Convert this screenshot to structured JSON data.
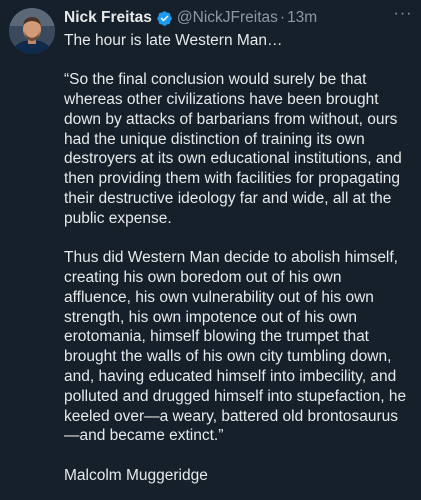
{
  "tweet": {
    "author": {
      "name": "Nick Freitas",
      "handle": "@NickJFreitas",
      "verified": true,
      "verified_color": "#1d9bf0"
    },
    "separator": "·",
    "timestamp": "13m",
    "more_icon": "ellipsis-icon",
    "more_label": "···",
    "paragraphs": {
      "intro": "The hour is late Western Man…",
      "quote1": "“So the final conclusion would surely be that whereas other civilizations have been brought down by attacks of barbarians from without, ours had the unique distinction of training its own destroyers at its own educational institutions, and then providing them with facilities for propagating their destructive ideology far and wide, all at the public expense.",
      "quote2": "Thus did Western Man decide to abolish himself, creating his own boredom out of his own affluence, his own vulnerability out of his own strength, his own impotence out of his own erotomania, himself blowing the trumpet that brought the walls of his own city tumbling down, and, having educated himself into imbecility, and polluted and drugged himself into stupefaction, he keeled over—a weary, battered old brontosaurus—and became extinct.”",
      "attribution": "Malcolm Muggeridge"
    }
  },
  "colors": {
    "background": "#15202b",
    "text_primary": "#e7e9ea",
    "text_secondary": "#8b98a5"
  }
}
